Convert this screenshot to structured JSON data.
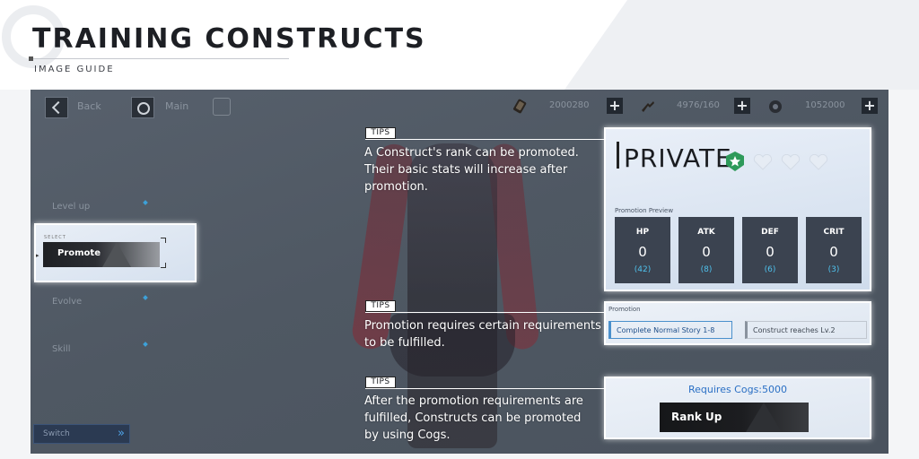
{
  "header": {
    "title": "TRAINING CONSTRUCTS",
    "subtitle": "IMAGE GUIDE"
  },
  "topbar": {
    "back_label": "Back",
    "main_label": "Main",
    "resources": [
      {
        "icon": "cog-resource-icon",
        "value": "2000280"
      },
      {
        "icon": "stamina-resource-icon",
        "value": "4976/160"
      },
      {
        "icon": "crystal-resource-icon",
        "value": "1052000"
      }
    ],
    "plus_label": "+"
  },
  "menu": {
    "items": [
      "Level up",
      "Evolve",
      "Skill"
    ],
    "promote_kicker": "SELECT",
    "promote_label": "Promote",
    "switch_label": "Switch",
    "switch_arrows": "»"
  },
  "rank_panel": {
    "rank": "PRIVATE",
    "preview_label": "Promotion Preview",
    "stats": [
      {
        "name": "HP",
        "value": "0",
        "next": "(42)"
      },
      {
        "name": "ATK",
        "value": "0",
        "next": "(8)"
      },
      {
        "name": "DEF",
        "value": "0",
        "next": "(6)"
      },
      {
        "name": "CRIT",
        "value": "0",
        "next": "(3)"
      }
    ]
  },
  "requirements_panel": {
    "title": "Promotion",
    "items": [
      "Complete Normal Story 1-8",
      "Construct reaches Lv.2"
    ]
  },
  "cogs_panel": {
    "requires_label": "Requires Cogs:5000",
    "button_label": "Rank Up"
  },
  "tips": {
    "tag": "TIPS",
    "rank_tip": [
      "A Construct's rank can be promoted.",
      "Their basic stats will increase after",
      "promotion."
    ],
    "requirement_tip": [
      "Promotion requires certain requirements",
      "to be fulfilled."
    ],
    "cogs_tip": [
      "After the promotion requirements are",
      "fulfilled, Constructs can be promoted",
      "by using Cogs."
    ]
  },
  "colors": {
    "accent_blue": "#4fc1ec",
    "link_blue": "#2a6fc4",
    "panel_dark": "#3b4350",
    "badge_green": "#2e9a5a"
  }
}
